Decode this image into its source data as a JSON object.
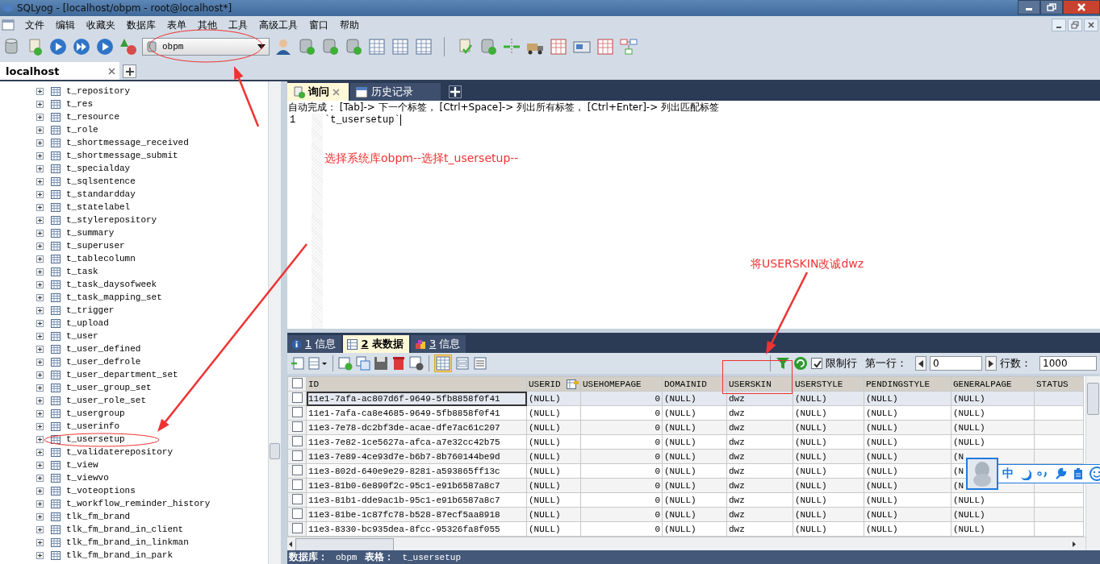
{
  "window": {
    "title": "SQLyog - [localhost/obpm - root@localhost*]"
  },
  "menu": [
    "文件",
    "编辑",
    "收藏夹",
    "数据库",
    "表单",
    "其他",
    "工具",
    "高级工具",
    "窗口",
    "帮助"
  ],
  "toolbar": {
    "database_select": "obpm"
  },
  "connection_tabs": [
    {
      "label": "localhost",
      "selected": true
    }
  ],
  "object_tree": {
    "items": [
      {
        "label": "t_repository",
        "expanded": false
      },
      {
        "label": "t_res",
        "expanded": false
      },
      {
        "label": "t_resource",
        "expanded": false
      },
      {
        "label": "t_role",
        "expanded": false
      },
      {
        "label": "t_shortmessage_received",
        "expanded": false
      },
      {
        "label": "t_shortmessage_submit",
        "expanded": false
      },
      {
        "label": "t_specialday",
        "expanded": false
      },
      {
        "label": "t_sqlsentence",
        "expanded": false
      },
      {
        "label": "t_standardday",
        "expanded": false
      },
      {
        "label": "t_statelabel",
        "expanded": false
      },
      {
        "label": "t_stylerepository",
        "expanded": false
      },
      {
        "label": "t_summary",
        "expanded": false
      },
      {
        "label": "t_superuser",
        "expanded": false
      },
      {
        "label": "t_tablecolumn",
        "expanded": false
      },
      {
        "label": "t_task",
        "expanded": false
      },
      {
        "label": "t_task_daysofweek",
        "expanded": false
      },
      {
        "label": "t_task_mapping_set",
        "expanded": false
      },
      {
        "label": "t_trigger",
        "expanded": false
      },
      {
        "label": "t_upload",
        "expanded": false
      },
      {
        "label": "t_user",
        "expanded": false
      },
      {
        "label": "t_user_defined",
        "expanded": false
      },
      {
        "label": "t_user_defrole",
        "expanded": false
      },
      {
        "label": "t_user_department_set",
        "expanded": false
      },
      {
        "label": "t_user_group_set",
        "expanded": false
      },
      {
        "label": "t_user_role_set",
        "expanded": false
      },
      {
        "label": "t_usergroup",
        "expanded": false
      },
      {
        "label": "t_userinfo",
        "expanded": false
      },
      {
        "label": "t_usersetup",
        "expanded": false
      },
      {
        "label": "t_validaterepository",
        "expanded": false
      },
      {
        "label": "t_view",
        "expanded": false
      },
      {
        "label": "t_viewvo",
        "expanded": false
      },
      {
        "label": "t_voteoptions",
        "expanded": false
      },
      {
        "label": "t_workflow_reminder_history",
        "expanded": false
      },
      {
        "label": "tlk_fm_brand",
        "expanded": false
      },
      {
        "label": "tlk_fm_brand_in_client",
        "expanded": false
      },
      {
        "label": "tlk_fm_brand_in_linkman",
        "expanded": false
      },
      {
        "label": "tlk_fm_brand_in_park",
        "expanded": false
      }
    ]
  },
  "query_tabs": [
    {
      "label": "询问",
      "selected": true,
      "kind": "query"
    },
    {
      "label": "历史记录",
      "selected": false,
      "kind": "history"
    }
  ],
  "editor": {
    "hint": "自动完成： [Tab]-> 下一个标签， [Ctrl+Space]-> 列出所有标签， [Ctrl+Enter]-> 列出匹配标签",
    "lines": [
      {
        "number": "1",
        "code": "`t_usersetup`"
      }
    ]
  },
  "result_tabs": [
    {
      "number": "1",
      "label": "信息",
      "selected": false,
      "kind": "info"
    },
    {
      "number": "2",
      "label": "表数据",
      "selected": true,
      "kind": "table"
    },
    {
      "number": "3",
      "label": "信息",
      "selected": false,
      "kind": "profile"
    }
  ],
  "result_toolbar": {
    "limit_rows": {
      "label": "限制行",
      "checked": true
    },
    "first_row": {
      "label": "第一行：",
      "value": "0"
    },
    "row_count": {
      "label": "行数：",
      "value": "1000"
    }
  },
  "grid": {
    "select_all": false,
    "columns": [
      "ID",
      "USERID",
      "USEHOMEPAGE",
      "DOMAINID",
      "USERSKIN",
      "USERSTYLE",
      "PENDINGSTYLE",
      "GENERALPAGE",
      "STATUS"
    ],
    "rows": [
      {
        "selected": true,
        "cells": [
          "11e1-7afa-ac807d6f-9649-5fb8858f0f41",
          "(NULL)",
          "0",
          "(NULL)",
          "dwz",
          "(NULL)",
          "(NULL)",
          "(NULL)"
        ]
      },
      {
        "selected": false,
        "cells": [
          "11e1-7afa-ca8e4685-9649-5fb8858f0f41",
          "(NULL)",
          "0",
          "(NULL)",
          "dwz",
          "(NULL)",
          "(NULL)",
          "(NULL)"
        ]
      },
      {
        "selected": false,
        "cells": [
          "11e3-7e78-dc2bf3de-acae-dfe7ac61c207",
          "(NULL)",
          "0",
          "(NULL)",
          "dwz",
          "(NULL)",
          "(NULL)",
          "(NULL)"
        ]
      },
      {
        "selected": false,
        "cells": [
          "11e3-7e82-1ce5627a-afca-a7e32cc42b75",
          "(NULL)",
          "0",
          "(NULL)",
          "dwz",
          "(NULL)",
          "(NULL)",
          "(NULL)"
        ]
      },
      {
        "selected": false,
        "cells": [
          "11e3-7e89-4ce93d7e-b6b7-8b760144be9d",
          "(NULL)",
          "0",
          "(NULL)",
          "dwz",
          "(NULL)",
          "(NULL)",
          "(N"
        ]
      },
      {
        "selected": false,
        "cells": [
          "11e3-802d-640e9e29-8281-a593865ff13c",
          "(NULL)",
          "0",
          "(NULL)",
          "dwz",
          "(NULL)",
          "(NULL)",
          "(N"
        ]
      },
      {
        "selected": false,
        "cells": [
          "11e3-81b0-6e890f2c-95c1-e91b6587a8c7",
          "(NULL)",
          "0",
          "(NULL)",
          "dwz",
          "(NULL)",
          "(NULL)",
          "(N"
        ]
      },
      {
        "selected": false,
        "cells": [
          "11e3-81b1-dde9ac1b-95c1-e91b6587a8c7",
          "(NULL)",
          "0",
          "(NULL)",
          "dwz",
          "(NULL)",
          "(NULL)",
          "(NULL)"
        ]
      },
      {
        "selected": false,
        "cells": [
          "11e3-81be-1c87fc78-b528-87ecf5aa8918",
          "(NULL)",
          "0",
          "(NULL)",
          "dwz",
          "(NULL)",
          "(NULL)",
          "(NULL)"
        ]
      },
      {
        "selected": false,
        "cells": [
          "11e3-8330-bc935dea-8fcc-95326fa8f055",
          "(NULL)",
          "0",
          "(NULL)",
          "dwz",
          "(NULL)",
          "(NULL)",
          "(NULL)"
        ]
      }
    ]
  },
  "status_bar": {
    "database_label": "数据库：",
    "database": "obpm",
    "table_label": "表格：",
    "table": "t_usersetup"
  },
  "ime_toolbar": {
    "mode": "中"
  },
  "annotations": [
    "选择系统库obpm--选择t_usersetup--",
    "将USERSKIN改诚dwz"
  ]
}
